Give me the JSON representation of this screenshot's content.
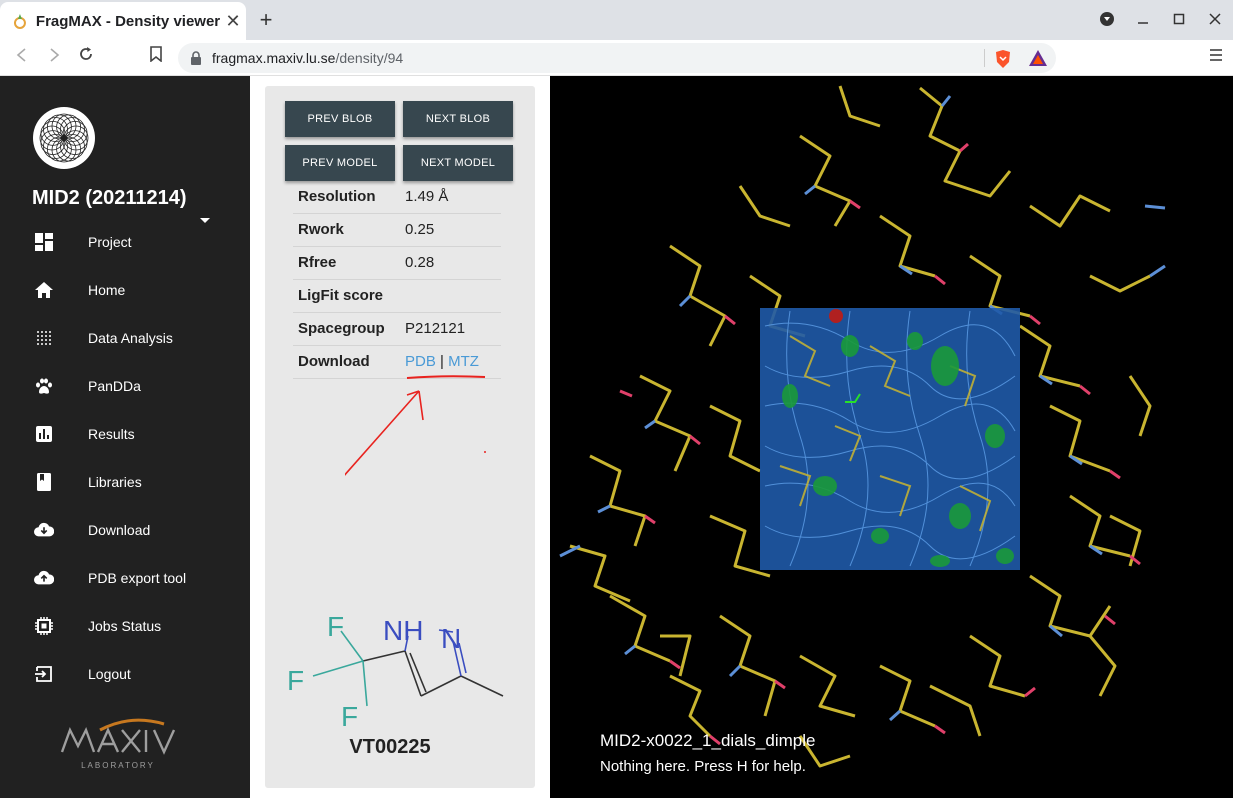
{
  "browser": {
    "tab_title": "FragMAX - Density viewer",
    "tab_close": "✕",
    "new_tab": "+",
    "url_host": "fragmax.maxiv.lu.se",
    "url_path": "/density/94"
  },
  "sidebar": {
    "project_title": "MID2 (20211214)",
    "items": [
      {
        "label": "Project",
        "icon": "dashboard-icon"
      },
      {
        "label": "Home",
        "icon": "home-icon"
      },
      {
        "label": "Data Analysis",
        "icon": "grid-dots-icon"
      },
      {
        "label": "PanDDa",
        "icon": "paw-icon"
      },
      {
        "label": "Results",
        "icon": "bar-chart-icon"
      },
      {
        "label": "Libraries",
        "icon": "book-icon"
      },
      {
        "label": "Download",
        "icon": "cloud-download-icon"
      },
      {
        "label": "PDB export tool",
        "icon": "cloud-upload-icon"
      },
      {
        "label": "Jobs Status",
        "icon": "chip-icon"
      },
      {
        "label": "Logout",
        "icon": "logout-icon"
      }
    ]
  },
  "panel": {
    "buttons": {
      "prev_blob": "PREV BLOB",
      "next_blob": "NEXT BLOB",
      "prev_model": "PREV MODEL",
      "next_model": "NEXT MODEL"
    },
    "rows": {
      "resolution": {
        "key": "Resolution",
        "value": "1.49 Å"
      },
      "rwork": {
        "key": "Rwork",
        "value": "0.25"
      },
      "rfree": {
        "key": "Rfree",
        "value": "0.28"
      },
      "ligfit": {
        "key": "LigFit score",
        "value": ""
      },
      "spacegroup": {
        "key": "Spacegroup",
        "value": "P212121"
      },
      "download": {
        "key": "Download",
        "pdb": "PDB",
        "sep": "|",
        "mtz": "MTZ"
      }
    },
    "compound_id": "VT00225"
  },
  "viewer": {
    "map_name": "MID2-x0022_1_dials_dimple",
    "help_text": "Nothing here. Press H for help."
  },
  "colors": {
    "sidebar_bg": "#212121",
    "button_bg": "#37474f",
    "link": "#4a9ad6",
    "carbon": "#c9b530",
    "density_mesh": "#2f74c8",
    "diff_density": "#1a9a3a",
    "annotation": "#e8231f"
  }
}
